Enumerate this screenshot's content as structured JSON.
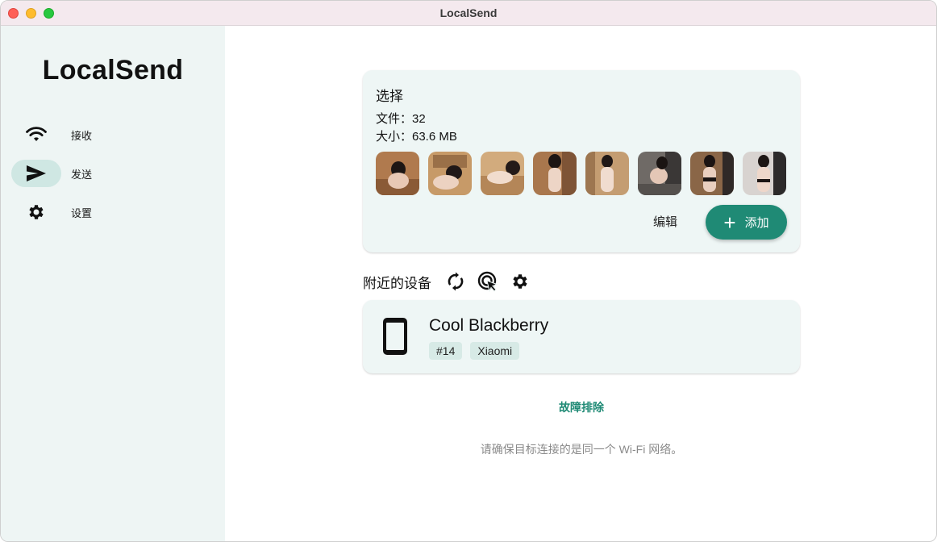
{
  "window": {
    "title": "LocalSend"
  },
  "sidebar": {
    "app_name": "LocalSend",
    "items": [
      {
        "label": "接收",
        "icon": "wifi-icon"
      },
      {
        "label": "发送",
        "icon": "send-icon",
        "active": true
      },
      {
        "label": "设置",
        "icon": "gear-icon"
      }
    ]
  },
  "selection": {
    "title": "选择",
    "files_line": "文件：32",
    "size_line": "大小：63.6 MB",
    "thumbnail_count_visible": 8,
    "edit_label": "编辑",
    "add_label": "添加"
  },
  "nearby": {
    "title": "附近的设备",
    "actions": [
      "refresh-icon",
      "target-scan-icon",
      "gear-icon"
    ]
  },
  "device": {
    "name": "Cool Blackberry",
    "tags": [
      "#14",
      "Xiaomi"
    ],
    "icon": "smartphone-icon"
  },
  "troubleshoot_label": "故障排除",
  "hint": "请确保目标连接的是同一个 Wi-Fi 网络。",
  "colors": {
    "accent": "#1f8a75",
    "sidebar_bg": "#eef5f4",
    "card_bg": "#eef6f5",
    "active_pill": "#cfe7e3",
    "titlebar_bg": "#f4e9ee"
  }
}
